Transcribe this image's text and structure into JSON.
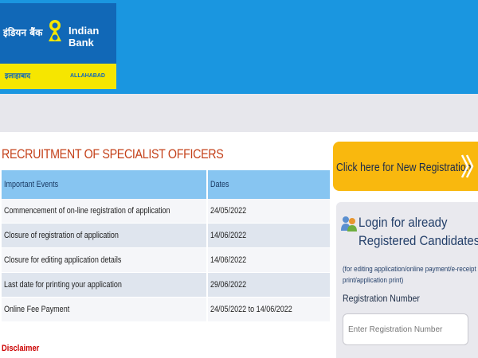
{
  "header": {
    "logo": {
      "hindi_name": "इंडियन बैंक",
      "english_name": "Indian Bank",
      "hindi_sub": "इलाहाबाद",
      "english_sub": "ALLAHABAD",
      "icon": "indian-bank-emblem"
    }
  },
  "main": {
    "title": "RECRUITMENT OF SPECIALIST OFFICERS",
    "table": {
      "columns": [
        "Important Events",
        "Dates"
      ],
      "rows": [
        {
          "event": "Commencement of on-line registration of application",
          "date": "24/05/2022"
        },
        {
          "event": "Closure of registration of application",
          "date": "14/06/2022"
        },
        {
          "event": "Closure for editing application details",
          "date": "14/06/2022"
        },
        {
          "event": "Last date for printing your application",
          "date": "29/06/2022"
        },
        {
          "event": "Online Fee Payment",
          "date": "24/05/2022 to 14/06/2022"
        }
      ]
    },
    "disclaimer_link": "Disclaimer"
  },
  "sidebar": {
    "new_registration": {
      "label": "Click here for New Registration",
      "icon": "double-chevron-right-icon"
    },
    "login": {
      "title_line1": "Login for already",
      "title_line2": "Registered Candidates",
      "note": "(for editing application/online payment/e-receipt print/application print)",
      "regno_label": "Registration Number",
      "regno_placeholder": "Enter Registration Number",
      "icon": "users-icon"
    }
  },
  "colors": {
    "header_blue": "#1a96e0",
    "heading_orange": "#c4411a",
    "table_header": "#87c5f1",
    "button_yellow": "#f9b80e",
    "disclaimer_red": "#cc0000"
  }
}
